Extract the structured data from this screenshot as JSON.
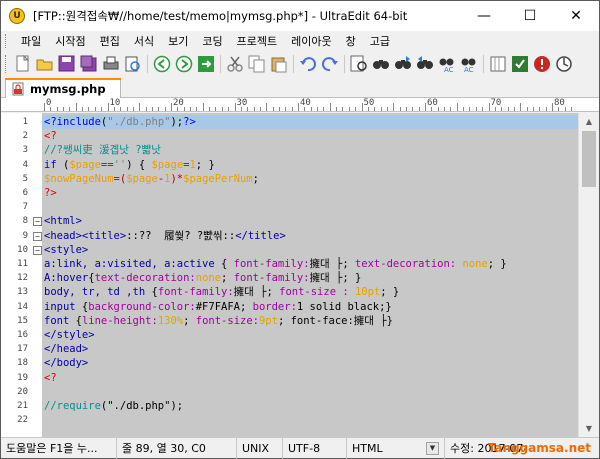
{
  "window": {
    "app_icon_letter": "U",
    "title": "[FTP::원격접속₩//home/test/memo|mymsg.php*] - UltraEdit 64-bit",
    "minimize": "—",
    "maximize": "☐",
    "close": "✕"
  },
  "menu": [
    "파일",
    "시작점",
    "편집",
    "서식",
    "보기",
    "코딩",
    "프로젝트",
    "레이아웃",
    "창",
    "고급"
  ],
  "toolbar_icons": [
    "new-file-icon",
    "open-folder-icon",
    "save-icon",
    "save-all-icon",
    "print-icon",
    "print-preview-icon",
    "back-icon",
    "forward-icon",
    "refresh-icon",
    "cut-icon",
    "copy-icon",
    "paste-icon",
    "undo-icon",
    "redo-icon",
    "find-in-files-icon",
    "find-icon",
    "find-next-icon",
    "find-prev-icon",
    "replace-icon",
    "replace-in-files-icon",
    "column-icon",
    "spell-icon",
    "web-icon",
    "settings-icon"
  ],
  "tab": {
    "label": "mymsg.php",
    "accent": "#ff8c00"
  },
  "ruler": {
    "labels": [
      "0",
      "10",
      "20",
      "30",
      "40",
      "50",
      "60",
      "70",
      "80"
    ]
  },
  "editor": {
    "current_line": 1,
    "lines": [
      {
        "n": "1",
        "fold": "",
        "segs": [
          [
            "c-kw",
            "<?"
          ],
          [
            "c-kw",
            "include"
          ],
          [
            "c-black",
            "("
          ],
          [
            "c-str",
            "\"./db.php\""
          ],
          [
            "c-black",
            ");"
          ],
          [
            "c-kw",
            "?>"
          ]
        ]
      },
      {
        "n": "2",
        "fold": "",
        "segs": [
          [
            "c-red",
            "<?"
          ]
        ]
      },
      {
        "n": "3",
        "fold": "",
        "segs": [
          [
            "c-cmt",
            "//?쌩씨吏 湲곕낫 ?뺣낫"
          ]
        ]
      },
      {
        "n": "4",
        "fold": "",
        "segs": [
          [
            "c-blue",
            "if"
          ],
          [
            "c-black",
            " ("
          ],
          [
            "c-var",
            "$page"
          ],
          [
            "c-op",
            "=="
          ],
          [
            "c-str",
            "''"
          ],
          [
            "c-black",
            ") { "
          ],
          [
            "c-var",
            "$page"
          ],
          [
            "c-op",
            "="
          ],
          [
            "c-num",
            "1"
          ],
          [
            "c-black",
            "; }"
          ]
        ]
      },
      {
        "n": "5",
        "fold": "",
        "segs": [
          [
            "c-var",
            "$nowPageNum"
          ],
          [
            "c-op",
            "=("
          ],
          [
            "c-var",
            "$page"
          ],
          [
            "c-op",
            "-"
          ],
          [
            "c-num",
            "1"
          ],
          [
            "c-op",
            ")*"
          ],
          [
            "c-var",
            "$pagePerNum"
          ],
          [
            "c-black",
            ";"
          ]
        ]
      },
      {
        "n": "6",
        "fold": "",
        "segs": [
          [
            "c-red",
            "?>"
          ]
        ]
      },
      {
        "n": "7",
        "fold": "",
        "segs": []
      },
      {
        "n": "8",
        "fold": "−",
        "segs": [
          [
            "c-tag",
            "<html>"
          ]
        ]
      },
      {
        "n": "9",
        "fold": "−",
        "segs": [
          [
            "c-tag",
            "<head><title>"
          ],
          [
            "c-black",
            "::??  履쒖? ?뺤씪::"
          ],
          [
            "c-tag",
            "</title>"
          ]
        ]
      },
      {
        "n": "10",
        "fold": "−",
        "segs": [
          [
            "c-tag",
            "<style>"
          ]
        ]
      },
      {
        "n": "11",
        "fold": "",
        "segs": [
          [
            "c-tag",
            "a:link, a:visited, a:active"
          ],
          [
            "c-black",
            " { "
          ],
          [
            "c-attr",
            "font-family:"
          ],
          [
            "c-black",
            "擁대 ├; "
          ],
          [
            "c-attr",
            "text-decoration: "
          ],
          [
            "c-var",
            "none"
          ],
          [
            "c-black",
            "; }"
          ]
        ]
      },
      {
        "n": "12",
        "fold": "",
        "segs": [
          [
            "c-tag",
            "A:hover"
          ],
          [
            "c-black",
            "{"
          ],
          [
            "c-attr",
            "text-decoration:"
          ],
          [
            "c-var",
            "none"
          ],
          [
            "c-black",
            "; "
          ],
          [
            "c-attr",
            "font-family:"
          ],
          [
            "c-black",
            "擁대 ├; }"
          ]
        ]
      },
      {
        "n": "13",
        "fold": "",
        "segs": [
          [
            "c-tag",
            "body, tr, td ,th"
          ],
          [
            "c-black",
            " {"
          ],
          [
            "c-attr",
            "font-family:"
          ],
          [
            "c-black",
            "擁대 ├; "
          ],
          [
            "c-attr",
            "font-size : "
          ],
          [
            "c-var",
            "10pt"
          ],
          [
            "c-black",
            "; }"
          ]
        ]
      },
      {
        "n": "14",
        "fold": "",
        "segs": [
          [
            "c-tag",
            "input"
          ],
          [
            "c-black",
            " {"
          ],
          [
            "c-attr",
            "background-color:"
          ],
          [
            "c-black",
            "#F7FAFA; "
          ],
          [
            "c-attr",
            "border:"
          ],
          [
            "c-black",
            "1 solid black;}"
          ]
        ]
      },
      {
        "n": "15",
        "fold": "",
        "segs": [
          [
            "c-tag",
            "font"
          ],
          [
            "c-black",
            " {"
          ],
          [
            "c-attr",
            "line-height:"
          ],
          [
            "c-var",
            "130%"
          ],
          [
            "c-black",
            "; "
          ],
          [
            "c-attr",
            "font-size:"
          ],
          [
            "c-var",
            "9pt"
          ],
          [
            "c-black",
            "; font-face:擁대 ├}"
          ]
        ]
      },
      {
        "n": "16",
        "fold": "",
        "segs": [
          [
            "c-tag",
            "</style>"
          ]
        ]
      },
      {
        "n": "17",
        "fold": "",
        "segs": [
          [
            "c-tag",
            "</head>"
          ]
        ]
      },
      {
        "n": "18",
        "fold": "",
        "segs": [
          [
            "c-tag",
            "</body>"
          ]
        ]
      },
      {
        "n": "19",
        "fold": "",
        "segs": [
          [
            "c-red",
            "<?"
          ]
        ]
      },
      {
        "n": "20",
        "fold": "",
        "segs": []
      },
      {
        "n": "21",
        "fold": "",
        "segs": [
          [
            "c-cmt",
            "//require"
          ],
          [
            "c-black",
            "(\"./db.php\");"
          ]
        ]
      },
      {
        "n": "22",
        "fold": "",
        "segs": []
      }
    ]
  },
  "status": {
    "help": "도움말은 F1을 누...",
    "position": "줄 89, 열 30, C0",
    "line_ending": "UNIX",
    "encoding": "UTF-8",
    "syntax": "HTML",
    "modified": "수정: 2017-07-",
    "watermark": "Tanggamsa.net"
  }
}
